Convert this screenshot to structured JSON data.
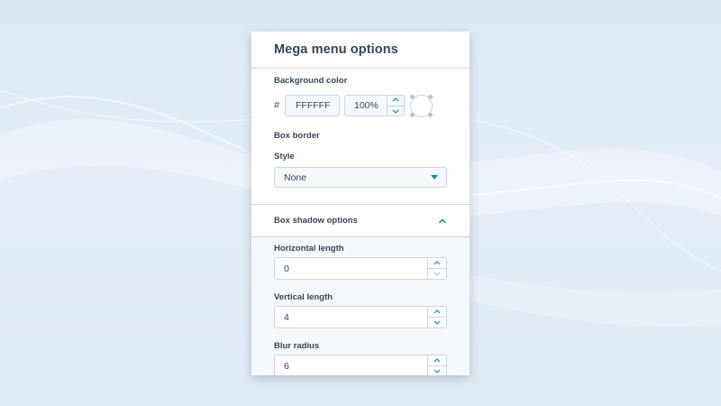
{
  "panel": {
    "title": "Mega menu options"
  },
  "background_color": {
    "label": "Background color",
    "hash": "#",
    "hex_value": "FFFFFF",
    "opacity_value": "100%",
    "swatch_color": "#ffffff"
  },
  "box_border": {
    "label": "Box border",
    "style_label": "Style",
    "style_value": "None"
  },
  "box_shadow": {
    "label": "Box shadow options",
    "expanded": true,
    "fields": [
      {
        "label": "Horizontal length",
        "value": "0"
      },
      {
        "label": "Vertical length",
        "value": "4"
      },
      {
        "label": "Blur radius",
        "value": "6"
      }
    ]
  },
  "colors": {
    "accent": "#0091ae",
    "text": "#33475b",
    "border": "#cbd6e2",
    "muted_bg": "#f5f8fa"
  },
  "icons": {
    "dropdown": "caret-down-icon",
    "collapse": "chevron-up-icon",
    "increment": "chevron-up-icon",
    "decrement": "chevron-down-icon"
  }
}
